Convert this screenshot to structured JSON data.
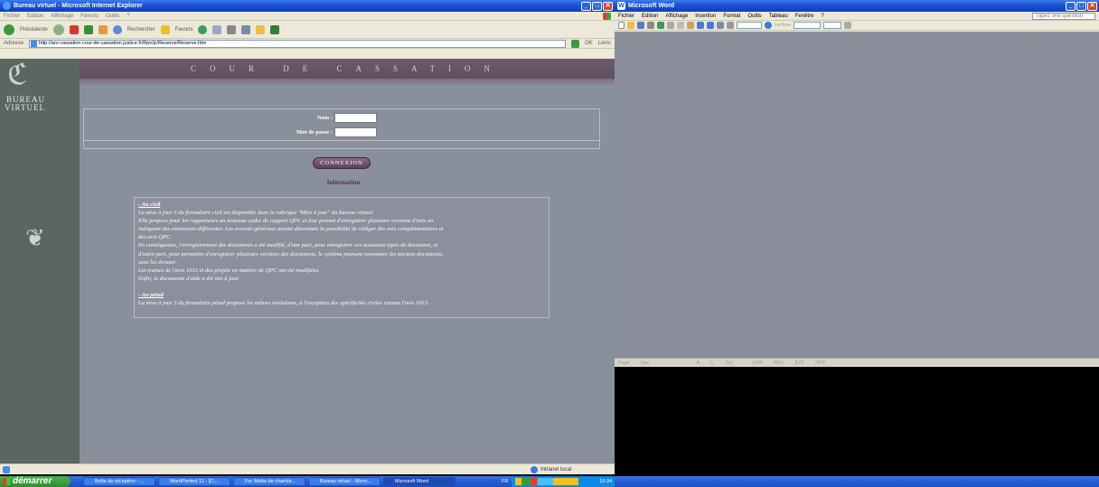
{
  "ie": {
    "title": "Bureau virtuel - Microsoft Internet Explorer",
    "menu": [
      "Fichier",
      "Edition",
      "Affichage",
      "Favoris",
      "Outils",
      "?"
    ],
    "toolbar": {
      "back": "Précédente",
      "search": "Rechercher",
      "favorites": "Favoris"
    },
    "address_label": "Adresse",
    "address_value": "http://arv-cassation.cour-de-cassation.justice.fr/Rpv/jc/Reserve/Reserve.htm",
    "go_label": "OK",
    "links_label": "Liens",
    "status_zone": "Intranet local"
  },
  "page": {
    "header": "COUR DE CASSATION",
    "logo_line1": "BUREAU",
    "logo_line2": "VIRTUEL",
    "login": {
      "name_label": "Nom :",
      "password_label": "Mot de passe :",
      "name_value": "",
      "password_value": ""
    },
    "connect_button": "CONNEXION",
    "info_title": "Information",
    "info": {
      "civil_heading": "- Au civil",
      "civil_lines": [
        "La mise à jour 6 du formulaire civil est disponible dans la rubrique \"Mise à jour\" du bureau virtuel.",
        "Elle propose pour les rapporteurs un nouveau cadre de rapport QPC et leur permet d'enregistrer plusieurs versions d'avis en",
        "indiquant des extensions différentes. Les avocats généraux auront désormais la possibilité de rédiger des avis complémentaires et",
        "des avis QPC.",
        "En conséquence, l'enregistrement des documents a été modifié, d'une part, pour enregistrer ces nouveaux types de document, et",
        "d'autre part, pour permettre d'enregistrer plusieurs versions des documents, le système pouvant renommer les anciens documents,",
        "sans les écraser.",
        "Les trames de l'avis 1015 et des projets en matière de QPC ont été modifiées.",
        "Enfin, le documents d'aide a été mis à jour."
      ],
      "penal_heading": "- Au pénal",
      "penal_lines": [
        "La mise à jour 3 du formulaire pénal propose les mêmes évolutions, à l'exception des spécificités civiles comme l'avis 1015."
      ]
    }
  },
  "word": {
    "title": "Microsoft Word",
    "menu": [
      "Fichier",
      "Edition",
      "Affichage",
      "Insertion",
      "Format",
      "Outils",
      "Tableau",
      "Fenêtre",
      "?"
    ],
    "help_box": "Tapez une question",
    "reading_label": "Lecture",
    "status": [
      "Page",
      "Sec",
      "À",
      "Li",
      "Col",
      "ENR",
      "REV",
      "EXT",
      "RFP"
    ]
  },
  "taskbar": {
    "start": "démarrer",
    "tasks": [
      "Boîte de réception - ...",
      "WordPerfect 11 - [C:...",
      "Fw: Motte de chambr...",
      "Bureau virtuel - Micro...",
      "Microsoft Word"
    ],
    "lang": "FR",
    "clock": "10:34"
  },
  "colors": {
    "title_blue": "#1e54d6",
    "page_grey": "#8a8f9c",
    "sidebar": "#5a6662",
    "header_purple": "#6e5a6a"
  }
}
